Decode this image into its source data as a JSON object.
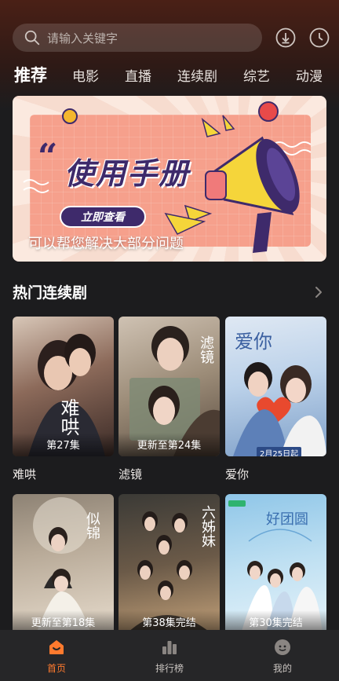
{
  "search": {
    "placeholder": "请输入关键字"
  },
  "tabs": [
    {
      "label": "推荐",
      "active": true
    },
    {
      "label": "电影"
    },
    {
      "label": "直播"
    },
    {
      "label": "连续剧"
    },
    {
      "label": "综艺"
    },
    {
      "label": "动漫"
    }
  ],
  "banner": {
    "title": "使用手册",
    "button": "立即查看",
    "caption": "可以帮您解决大部分问题"
  },
  "section": {
    "title": "热门连续剧"
  },
  "shows": [
    {
      "name": "难哄",
      "episode": "第27集",
      "poster_text": "难哄"
    },
    {
      "name": "滤镜",
      "episode": "更新至第24集",
      "poster_text": "滤镜"
    },
    {
      "name": "爱你",
      "episode": "",
      "poster_text": "爱你",
      "poster_date": "2月25日起"
    },
    {
      "name": "",
      "episode": "更新至第18集",
      "poster_text": "似锦"
    },
    {
      "name": "",
      "episode": "第38集完结",
      "poster_text": "六姊妹"
    },
    {
      "name": "",
      "episode": "第30集完结",
      "poster_text": "好团圆"
    }
  ],
  "nav": [
    {
      "label": "首页",
      "active": true,
      "icon": "home-icon"
    },
    {
      "label": "排行榜",
      "icon": "ranking-icon"
    },
    {
      "label": "我的",
      "icon": "profile-icon"
    }
  ],
  "colors": {
    "accent": "#ff7a2e",
    "background": "#1c1c1e",
    "header": "#4a2016"
  }
}
